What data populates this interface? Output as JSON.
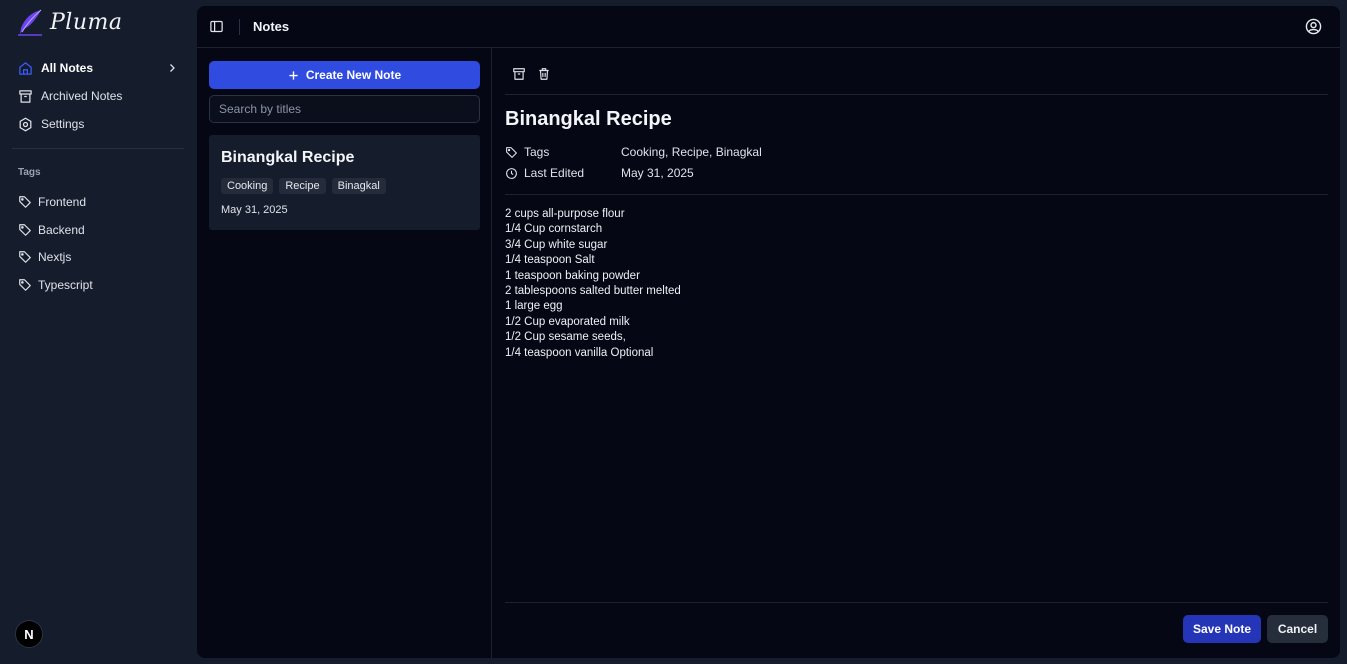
{
  "app": {
    "name": "Pluma"
  },
  "sidebar": {
    "items": [
      {
        "label": "All Notes",
        "icon": "home-icon",
        "active": true
      },
      {
        "label": "Archived Notes",
        "icon": "archive-icon",
        "active": false
      },
      {
        "label": "Settings",
        "icon": "settings-icon",
        "active": false
      }
    ],
    "tags_title": "Tags",
    "tags": [
      {
        "label": "Frontend",
        "icon": "tag-icon"
      },
      {
        "label": "Backend",
        "icon": "tag-icon"
      },
      {
        "label": "Nextjs",
        "icon": "tag-icon"
      },
      {
        "label": "Typescript",
        "icon": "tag-icon"
      }
    ],
    "badge": "N"
  },
  "header": {
    "title": "Notes"
  },
  "list": {
    "create_label": "Create New Note",
    "search_placeholder": "Search by titles",
    "notes": [
      {
        "title": "Binangkal Recipe",
        "tags": [
          "Cooking",
          "Recipe",
          "Binagkal"
        ],
        "date": "May 31, 2025"
      }
    ]
  },
  "editor": {
    "title": "Binangkal Recipe",
    "tags_label": "Tags",
    "tags_value": "Cooking, Recipe, Binagkal",
    "edited_label": "Last Edited",
    "edited_value": "May 31, 2025",
    "body_lines": [
      "2 cups all-purpose flour",
      "1/4 Cup cornstarch",
      "3/4 Cup white sugar",
      "1/4 teaspoon Salt",
      "1 teaspoon baking powder",
      "2 tablespoons salted butter melted",
      "1 large egg",
      "1/2 Cup evaporated milk",
      "1/2 Cup sesame seeds,",
      "1/4 teaspoon vanilla Optional"
    ],
    "save_label": "Save Note",
    "cancel_label": "Cancel"
  },
  "colors": {
    "accent": "#2f4be0",
    "save": "#2535b8",
    "sidebar_bg": "#151c2b",
    "panel_bg": "#050814",
    "logo_purple": "#6d44f0"
  }
}
